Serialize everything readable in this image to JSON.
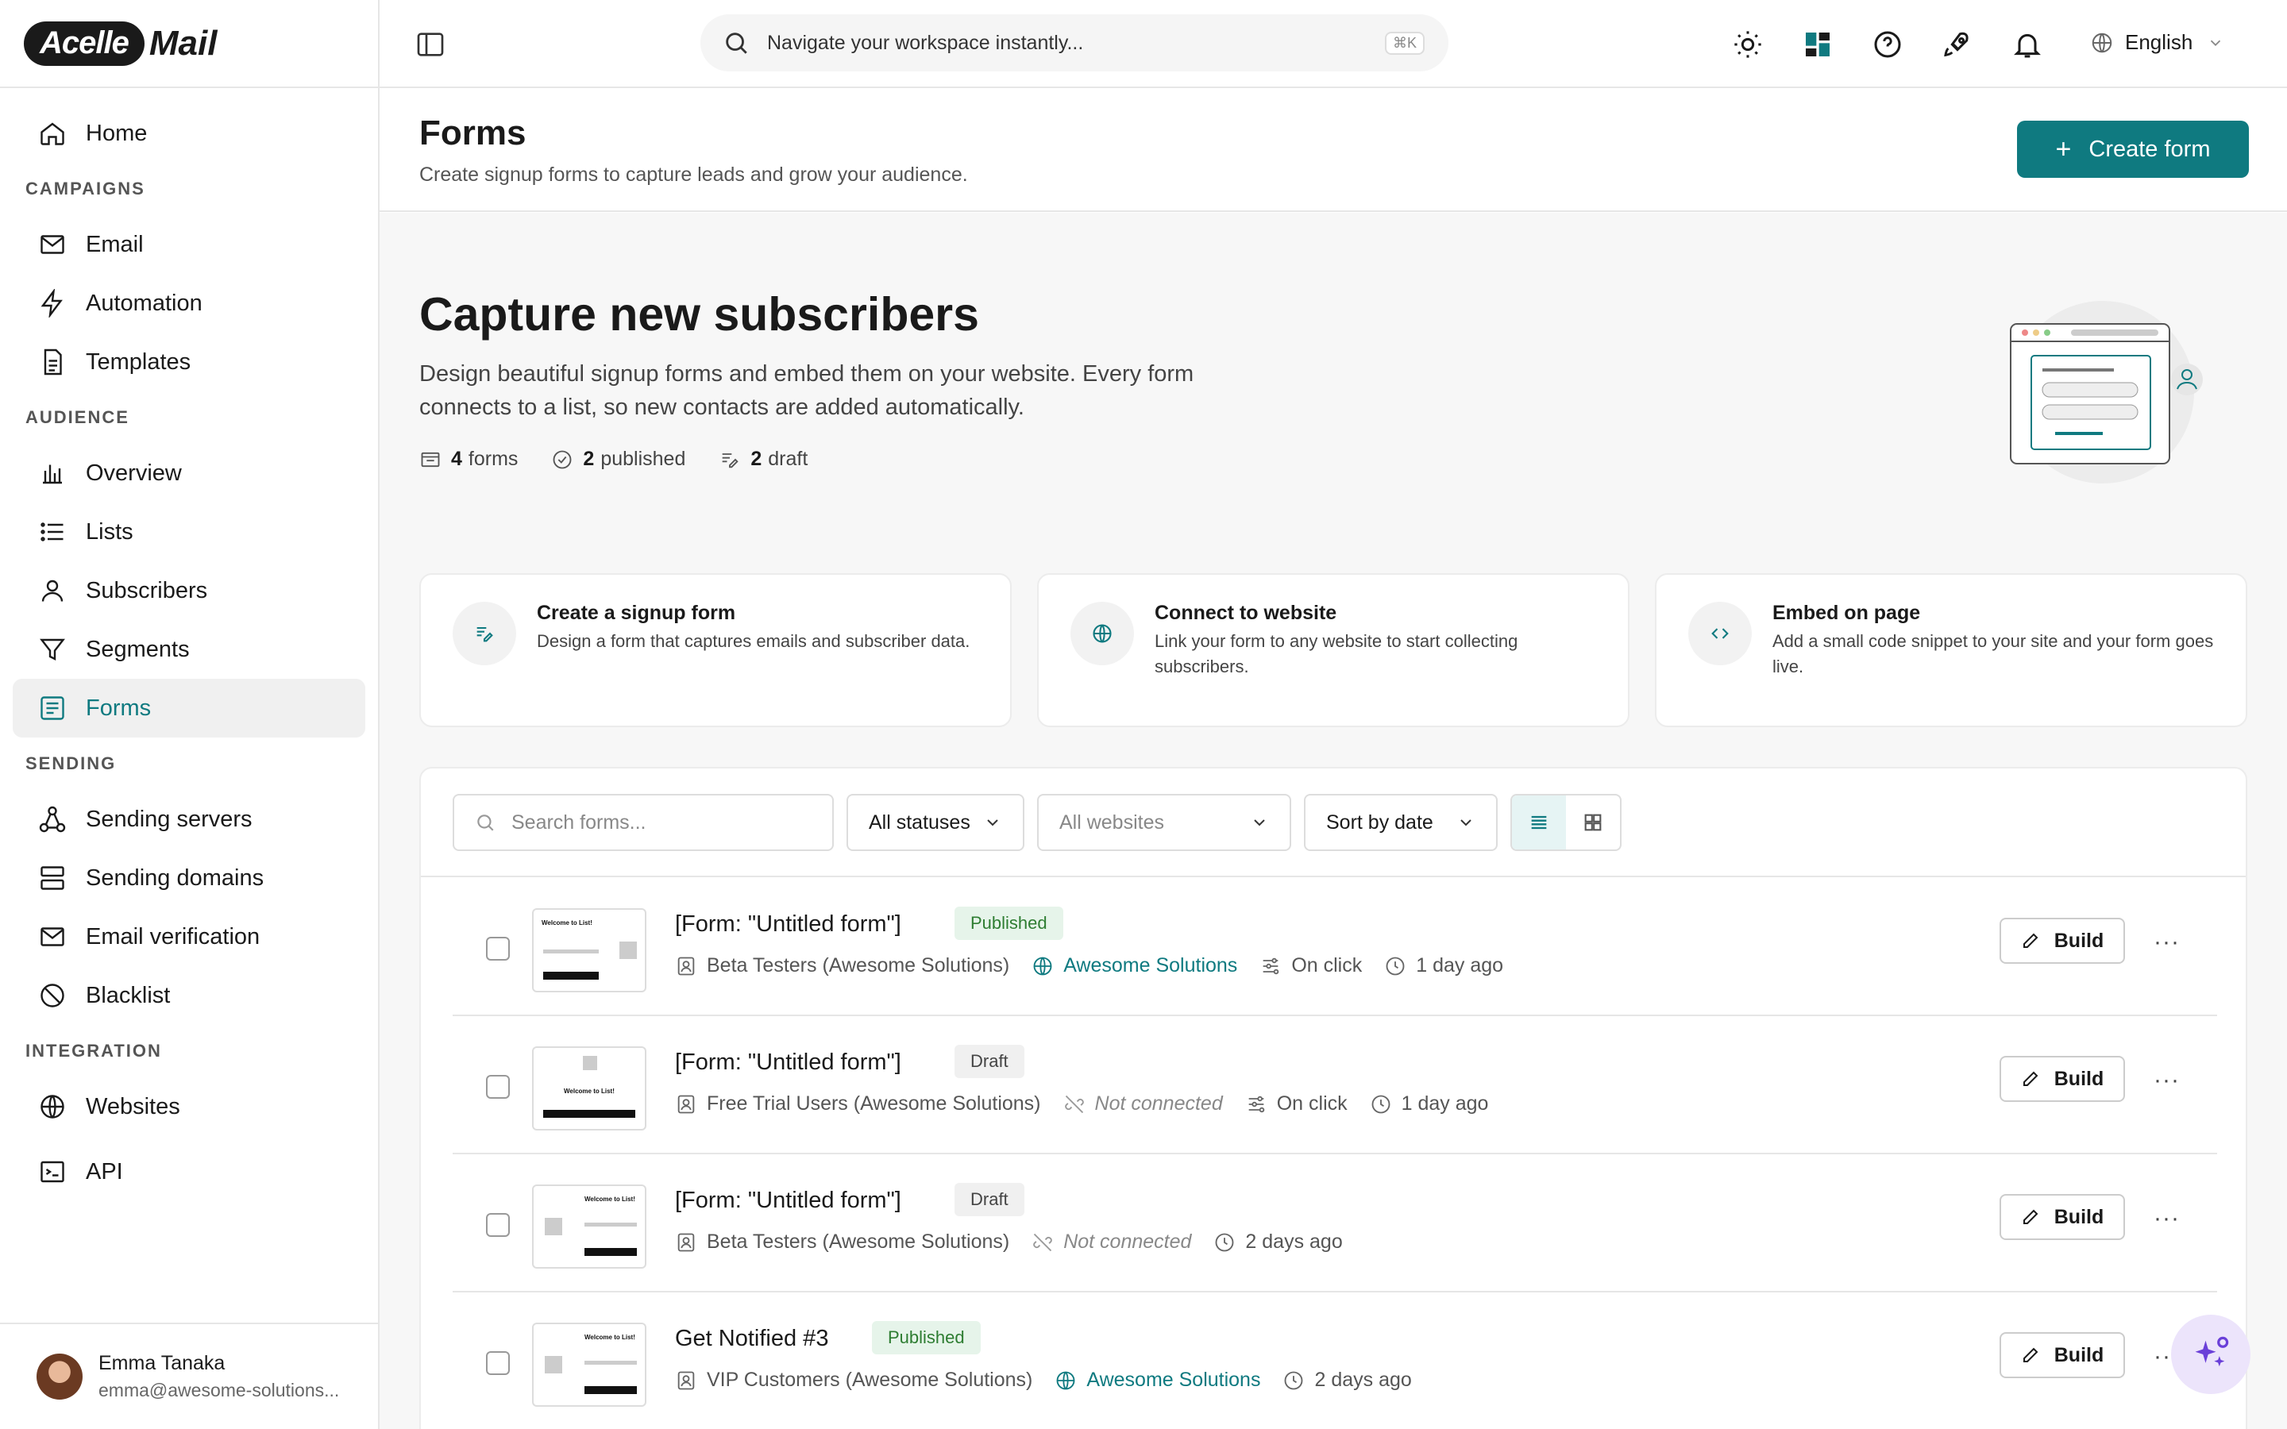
{
  "app": {
    "logo_left": "Acelle",
    "logo_right": "Mail"
  },
  "sidebar": {
    "home": "Home",
    "sections": {
      "campaigns": "CAMPAIGNS",
      "audience": "AUDIENCE",
      "sending": "SENDING",
      "integration": "INTEGRATION"
    },
    "items": {
      "email": "Email",
      "automation": "Automation",
      "templates": "Templates",
      "overview": "Overview",
      "lists": "Lists",
      "subscribers": "Subscribers",
      "segments": "Segments",
      "forms": "Forms",
      "sending_servers": "Sending servers",
      "sending_domains": "Sending domains",
      "email_verification": "Email verification",
      "blacklist": "Blacklist",
      "websites": "Websites",
      "api": "API"
    },
    "active": "forms",
    "user": {
      "name": "Emma Tanaka",
      "email": "emma@awesome-solutions..."
    }
  },
  "topbar": {
    "search_placeholder": "Navigate your workspace instantly...",
    "shortcut": "⌘K",
    "language": "English"
  },
  "header": {
    "title": "Forms",
    "subtitle": "Create signup forms to capture leads and grow your audience.",
    "create_label": "Create form"
  },
  "hero": {
    "title": "Capture new subscribers",
    "description": "Design beautiful signup forms and embed them on your website. Every form connects to a list, so new contacts are added automatically.",
    "stats": {
      "forms_count": "4",
      "forms_label": "forms",
      "published_count": "2",
      "published_label": "published",
      "draft_count": "2",
      "draft_label": "draft"
    }
  },
  "steps": [
    {
      "title": "Create a signup form",
      "desc": "Design a form that captures emails and subscriber data."
    },
    {
      "title": "Connect to website",
      "desc": "Link your form to any website to start collecting subscribers."
    },
    {
      "title": "Embed on page",
      "desc": "Add a small code snippet to your site and your form goes live."
    }
  ],
  "filters": {
    "search_placeholder": "Search forms...",
    "status": "All statuses",
    "website": "All websites",
    "sort": "Sort by date"
  },
  "forms": [
    {
      "title": "[Form: \"Untitled form\"]",
      "status": "Published",
      "list": "Beta Testers (Awesome Solutions)",
      "website": "Awesome Solutions",
      "trigger": "On click",
      "time": "1 day ago",
      "thumb_text": "Welcome to List!",
      "thumb_submit": "SUBMIT"
    },
    {
      "title": "[Form: \"Untitled form\"]",
      "status": "Draft",
      "list": "Free Trial Users (Awesome Solutions)",
      "website": "Not connected",
      "trigger": "On click",
      "time": "1 day ago",
      "thumb_text": "Welcome to List!",
      "thumb_submit": "SUBMIT"
    },
    {
      "title": "[Form: \"Untitled form\"]",
      "status": "Draft",
      "list": "Beta Testers (Awesome Solutions)",
      "website": "Not connected",
      "trigger": "",
      "time": "2 days ago",
      "thumb_text": "Welcome to List!",
      "thumb_submit": "SUBMIT"
    },
    {
      "title": "Get Notified #3",
      "status": "Published",
      "list": "VIP Customers (Awesome Solutions)",
      "website": "Awesome Solutions",
      "trigger": "",
      "time": "2 days ago",
      "thumb_text": "Welcome to List!",
      "thumb_submit": "SUBMIT"
    }
  ],
  "row_actions": {
    "build": "Build",
    "more": "···"
  },
  "colors": {
    "accent": "#0f7a80",
    "published_bg": "#e6f4ea",
    "published_fg": "#2e7d32",
    "draft_bg": "#f0f0f0"
  }
}
